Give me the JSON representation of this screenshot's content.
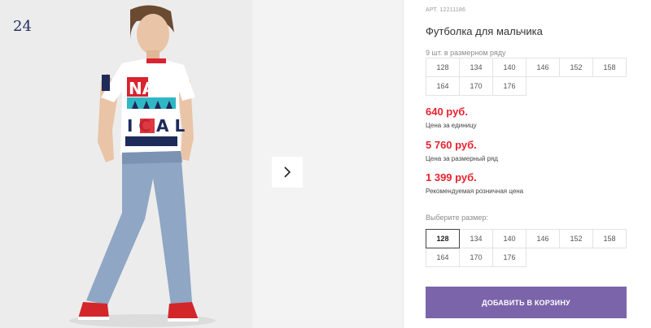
{
  "gallery": {
    "slide_number": "24",
    "next_icon": "chevron-right-icon",
    "colors": {
      "background": "#ededed",
      "tshirt": "#ffffff",
      "accent_red": "#d9232e",
      "navy": "#1e2a5a",
      "jeans": "#8fa6c4",
      "shoes": "#d3262a"
    }
  },
  "product": {
    "art": "АРТ. 12211186",
    "title": "Футболка для мальчика",
    "pack_label": "9 шт. в размерном ряду",
    "pack_sizes": [
      [
        "128",
        "134",
        "140",
        "146",
        "152",
        "158"
      ],
      [
        "164",
        "170",
        "176"
      ]
    ],
    "prices": [
      {
        "value": "640 руб.",
        "caption": "Цена за единицу"
      },
      {
        "value": "5 760 руб.",
        "caption": "Цена за размерный ряд"
      },
      {
        "value": "1 399 руб.",
        "caption": "Рекомендуемая розничная цена"
      }
    ],
    "choose_size_label": "Выберите размер:",
    "select_sizes": [
      [
        "128",
        "134",
        "140",
        "146",
        "152",
        "158"
      ],
      [
        "164",
        "170",
        "176"
      ]
    ],
    "selected_size": "128",
    "add_to_cart": "ДОБАВИТЬ В КОРЗИНУ",
    "accent_color": "#7b64aa",
    "price_color": "#e8232f"
  }
}
